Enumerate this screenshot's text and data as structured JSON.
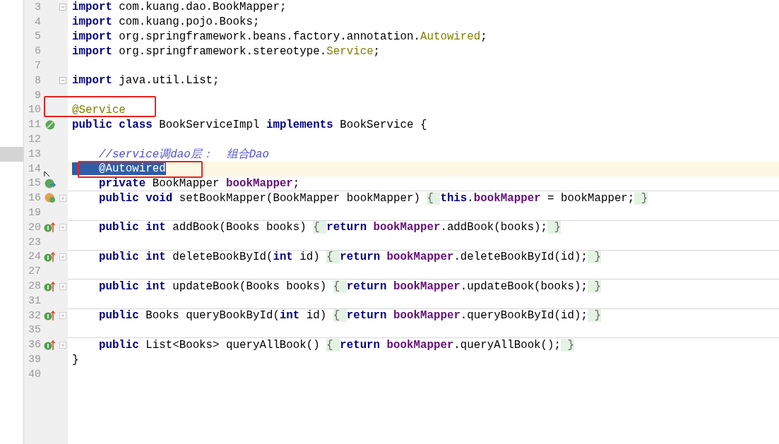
{
  "editor": {
    "lines": [
      {
        "number": "3",
        "fold": {
          "kind": "open"
        },
        "current": false,
        "divider_above": false,
        "marker": false,
        "caret": false,
        "pointer": false,
        "tokens": [
          {
            "kind": "kw",
            "t": "import"
          },
          {
            "kind": "p",
            "t": " com.kuang.dao.BookMapper;"
          }
        ]
      },
      {
        "number": "4",
        "current": false,
        "divider_above": false,
        "marker": false,
        "caret": false,
        "pointer": false,
        "tokens": [
          {
            "kind": "kw",
            "t": "import"
          },
          {
            "kind": "p",
            "t": " com.kuang.pojo.Books;"
          }
        ]
      },
      {
        "number": "5",
        "current": false,
        "divider_above": false,
        "marker": false,
        "caret": false,
        "pointer": false,
        "tokens": [
          {
            "kind": "kw",
            "t": "import"
          },
          {
            "kind": "p",
            "t": " org.springframework.beans.factory.annotation."
          },
          {
            "kind": "an",
            "t": "Autowired"
          },
          {
            "kind": "p",
            "t": ";"
          }
        ]
      },
      {
        "number": "6",
        "current": false,
        "divider_above": false,
        "marker": false,
        "caret": false,
        "pointer": false,
        "tokens": [
          {
            "kind": "kw",
            "t": "import"
          },
          {
            "kind": "p",
            "t": " org.springframework.stereotype."
          },
          {
            "kind": "an",
            "t": "Service"
          },
          {
            "kind": "p",
            "t": ";"
          }
        ]
      },
      {
        "number": "7",
        "current": false,
        "divider_above": false,
        "marker": false,
        "caret": false,
        "pointer": false
      },
      {
        "number": "8",
        "fold": {
          "kind": "open"
        },
        "current": false,
        "divider_above": false,
        "marker": false,
        "caret": false,
        "pointer": false,
        "tokens": [
          {
            "kind": "kw",
            "t": "import"
          },
          {
            "kind": "p",
            "t": " java.util.List;"
          }
        ]
      },
      {
        "number": "9",
        "current": false,
        "divider_above": false,
        "marker": false,
        "caret": false,
        "pointer": false
      },
      {
        "number": "10",
        "current": false,
        "divider_above": false,
        "marker": false,
        "caret": false,
        "pointer": false,
        "tokens": [
          {
            "kind": "an",
            "t": "@Service"
          }
        ]
      },
      {
        "number": "11",
        "gutter_icon": {
          "kind": "bean"
        },
        "current": false,
        "divider_above": false,
        "marker": false,
        "caret": false,
        "pointer": false,
        "tokens": [
          {
            "kind": "kw",
            "t": "public class"
          },
          {
            "kind": "p",
            "t": " BookServiceImpl "
          },
          {
            "kind": "kw",
            "t": "implements"
          },
          {
            "kind": "p",
            "t": " BookService {"
          }
        ]
      },
      {
        "number": "12",
        "current": false,
        "divider_above": false,
        "marker": false,
        "caret": false,
        "pointer": false
      },
      {
        "number": "13",
        "current": false,
        "divider_above": false,
        "marker": true,
        "caret": false,
        "pointer": false,
        "tokens": [
          {
            "kind": "c",
            "t": "    //service调dao层：  组合Dao"
          }
        ]
      },
      {
        "number": "14",
        "current": true,
        "divider_above": false,
        "marker": false,
        "caret": true,
        "pointer": true,
        "tokens": [
          {
            "kind": "sel",
            "t": "    @Autowired"
          }
        ]
      },
      {
        "number": "15",
        "gutter_icon": {
          "kind": "bean-arrow"
        },
        "current": false,
        "divider_above": false,
        "marker": false,
        "caret": false,
        "pointer": false,
        "tokens": [
          {
            "kind": "kw",
            "t": "    private"
          },
          {
            "kind": "p",
            "t": " BookMapper "
          },
          {
            "kind": "f",
            "t": "bookMapper"
          },
          {
            "kind": "p",
            "t": ";"
          }
        ]
      },
      {
        "number": "16",
        "gutter_icon": {
          "kind": "property"
        },
        "fold": {
          "kind": "closed"
        },
        "current": false,
        "divider_above": true,
        "marker": false,
        "caret": false,
        "pointer": false,
        "tokens": [
          {
            "kind": "kw",
            "t": "    public void"
          },
          {
            "kind": "p",
            "t": " setBookMapper(BookMapper bookMapper) "
          },
          {
            "kind": "fold",
            "t": "{ "
          },
          {
            "kind": "kw",
            "t": "this"
          },
          {
            "kind": "p",
            "t": "."
          },
          {
            "kind": "f",
            "t": "bookMapper"
          },
          {
            "kind": "p",
            "t": " = bookMapper;"
          },
          {
            "kind": "fold",
            "t": " }"
          }
        ]
      },
      {
        "number": "19",
        "current": false,
        "divider_above": false,
        "marker": false,
        "caret": false,
        "pointer": false
      },
      {
        "number": "20",
        "gutter_icon": {
          "kind": "implements"
        },
        "fold": {
          "kind": "closed"
        },
        "current": false,
        "divider_above": true,
        "marker": false,
        "caret": false,
        "pointer": false,
        "tokens": [
          {
            "kind": "kw",
            "t": "    public int"
          },
          {
            "kind": "p",
            "t": " addBook(Books books) "
          },
          {
            "kind": "fold",
            "t": "{ "
          },
          {
            "kind": "kw",
            "t": "return "
          },
          {
            "kind": "f",
            "t": "bookMapper"
          },
          {
            "kind": "p",
            "t": ".addBook(books);"
          },
          {
            "kind": "fold",
            "t": " }"
          }
        ]
      },
      {
        "number": "23",
        "current": false,
        "divider_above": false,
        "marker": false,
        "caret": false,
        "pointer": false
      },
      {
        "number": "24",
        "gutter_icon": {
          "kind": "implements"
        },
        "fold": {
          "kind": "closed"
        },
        "current": false,
        "divider_above": true,
        "marker": false,
        "caret": false,
        "pointer": false,
        "tokens": [
          {
            "kind": "kw",
            "t": "    public int"
          },
          {
            "kind": "p",
            "t": " deleteBookById("
          },
          {
            "kind": "kw",
            "t": "int"
          },
          {
            "kind": "p",
            "t": " id) "
          },
          {
            "kind": "fold",
            "t": "{ "
          },
          {
            "kind": "kw",
            "t": "return "
          },
          {
            "kind": "f",
            "t": "bookMapper"
          },
          {
            "kind": "p",
            "t": ".deleteBookById(id);"
          },
          {
            "kind": "fold",
            "t": " }"
          }
        ]
      },
      {
        "number": "27",
        "current": false,
        "divider_above": false,
        "marker": false,
        "caret": false,
        "pointer": false
      },
      {
        "number": "28",
        "gutter_icon": {
          "kind": "implements"
        },
        "fold": {
          "kind": "closed"
        },
        "current": false,
        "divider_above": true,
        "marker": false,
        "caret": false,
        "pointer": false,
        "tokens": [
          {
            "kind": "kw",
            "t": "    public int"
          },
          {
            "kind": "p",
            "t": " updateBook(Books books) "
          },
          {
            "kind": "fold",
            "t": "{ "
          },
          {
            "kind": "kw",
            "t": "return "
          },
          {
            "kind": "f",
            "t": "bookMapper"
          },
          {
            "kind": "p",
            "t": ".updateBook(books);"
          },
          {
            "kind": "fold",
            "t": " }"
          }
        ]
      },
      {
        "number": "31",
        "current": false,
        "divider_above": false,
        "marker": false,
        "caret": false,
        "pointer": false
      },
      {
        "number": "32",
        "gutter_icon": {
          "kind": "implements"
        },
        "fold": {
          "kind": "closed"
        },
        "current": false,
        "divider_above": true,
        "marker": false,
        "caret": false,
        "pointer": false,
        "tokens": [
          {
            "kind": "kw",
            "t": "    public"
          },
          {
            "kind": "p",
            "t": " Books queryBookById("
          },
          {
            "kind": "kw",
            "t": "int"
          },
          {
            "kind": "p",
            "t": " id) "
          },
          {
            "kind": "fold",
            "t": "{ "
          },
          {
            "kind": "kw",
            "t": "return "
          },
          {
            "kind": "f",
            "t": "bookMapper"
          },
          {
            "kind": "p",
            "t": ".queryBookById(id);"
          },
          {
            "kind": "fold",
            "t": " }"
          }
        ]
      },
      {
        "number": "35",
        "current": false,
        "divider_above": false,
        "marker": false,
        "caret": false,
        "pointer": false
      },
      {
        "number": "36",
        "gutter_icon": {
          "kind": "implements"
        },
        "fold": {
          "kind": "closed"
        },
        "current": false,
        "divider_above": true,
        "marker": false,
        "caret": false,
        "pointer": false,
        "tokens": [
          {
            "kind": "kw",
            "t": "    public"
          },
          {
            "kind": "p",
            "t": " List<Books> queryAllBook() "
          },
          {
            "kind": "fold",
            "t": "{ "
          },
          {
            "kind": "kw",
            "t": "return "
          },
          {
            "kind": "f",
            "t": "bookMapper"
          },
          {
            "kind": "p",
            "t": ".queryAllBook();"
          },
          {
            "kind": "fold",
            "t": " }"
          }
        ]
      },
      {
        "number": "39",
        "current": false,
        "divider_above": false,
        "marker": false,
        "caret": false,
        "pointer": false,
        "tokens": [
          {
            "kind": "p",
            "t": "}"
          }
        ]
      },
      {
        "number": "40",
        "current": false,
        "divider_above": false,
        "marker": false,
        "caret": false,
        "pointer": false
      }
    ],
    "annotation_boxes": [
      {
        "kind": "box"
      },
      {
        "kind": "box"
      }
    ]
  }
}
